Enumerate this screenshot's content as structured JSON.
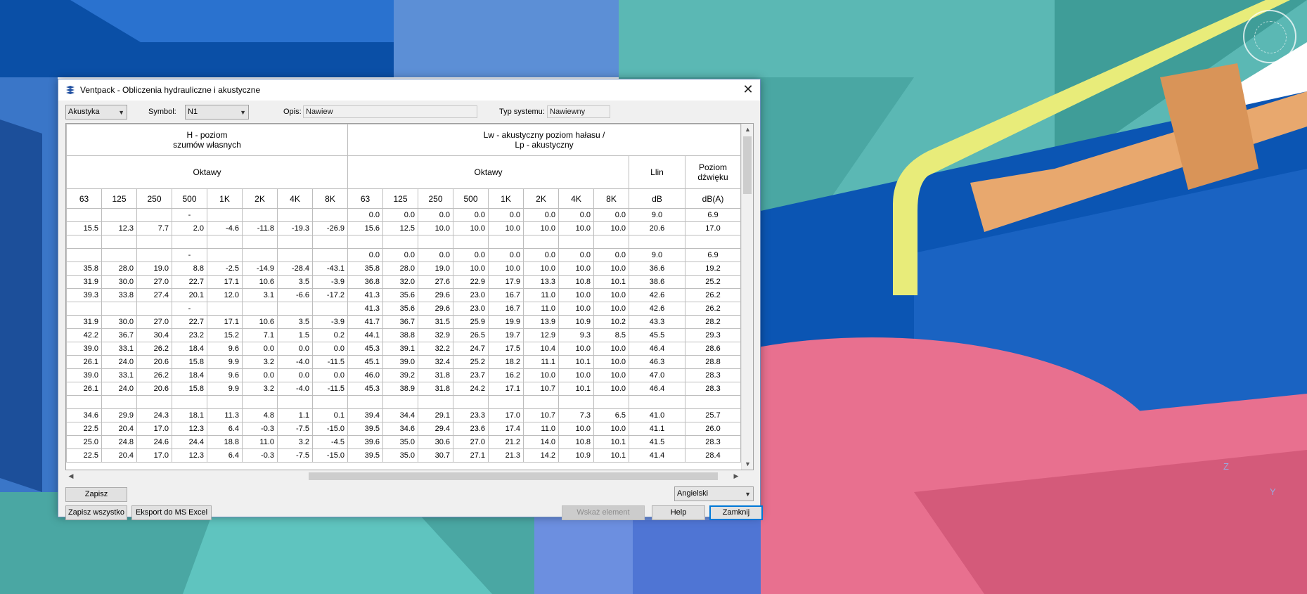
{
  "dialog": {
    "title": "Ventpack - Obliczenia hydrauliczne i akustyczne",
    "mode_select": "Akustyka",
    "symbol_label": "Symbol:",
    "symbol_value": "N1",
    "desc_label": "Opis:",
    "desc_value": "Nawiew",
    "system_type_label": "Typ systemu:",
    "system_type_value": "Nawiewny"
  },
  "table": {
    "group_h_line1": "H - poziom",
    "group_h_line2": "szumów własnych",
    "group_lw_line1": "Lw - akustyczny poziom hałasu /",
    "group_lw_line2": "Lp - akustyczny",
    "octaves_label_left": "Oktawy",
    "octaves_label_right": "Oktawy",
    "llin_label": "Llin",
    "sound_level_line1": "Poziom",
    "sound_level_line2": "dźwięku",
    "octave_bands": [
      "63",
      "125",
      "250",
      "500",
      "1K",
      "2K",
      "4K",
      "8K"
    ],
    "db_unit": "dB",
    "dba_unit": "dB(A)",
    "rows": [
      {
        "h": [
          "",
          "",
          "",
          "-",
          "",
          "",
          "",
          ""
        ],
        "lw": [
          "0.0",
          "0.0",
          "0.0",
          "0.0",
          "0.0",
          "0.0",
          "0.0",
          "0.0"
        ],
        "llin": "9.0",
        "la": "6.9"
      },
      {
        "h": [
          "15.5",
          "12.3",
          "7.7",
          "2.0",
          "-4.6",
          "-11.8",
          "-19.3",
          "-26.9"
        ],
        "lw": [
          "15.6",
          "12.5",
          "10.0",
          "10.0",
          "10.0",
          "10.0",
          "10.0",
          "10.0"
        ],
        "llin": "20.6",
        "la": "17.0"
      },
      {
        "h": [
          "",
          "",
          "",
          "",
          "",
          "",
          "",
          ""
        ],
        "lw": [
          "",
          "",
          "",
          "",
          "",
          "",
          "",
          ""
        ],
        "llin": "",
        "la": ""
      },
      {
        "h": [
          "",
          "",
          "",
          "-",
          "",
          "",
          "",
          ""
        ],
        "lw": [
          "0.0",
          "0.0",
          "0.0",
          "0.0",
          "0.0",
          "0.0",
          "0.0",
          "0.0"
        ],
        "llin": "9.0",
        "la": "6.9"
      },
      {
        "h": [
          "35.8",
          "28.0",
          "19.0",
          "8.8",
          "-2.5",
          "-14.9",
          "-28.4",
          "-43.1"
        ],
        "lw": [
          "35.8",
          "28.0",
          "19.0",
          "10.0",
          "10.0",
          "10.0",
          "10.0",
          "10.0"
        ],
        "llin": "36.6",
        "la": "19.2"
      },
      {
        "h": [
          "31.9",
          "30.0",
          "27.0",
          "22.7",
          "17.1",
          "10.6",
          "3.5",
          "-3.9"
        ],
        "lw": [
          "36.8",
          "32.0",
          "27.6",
          "22.9",
          "17.9",
          "13.3",
          "10.8",
          "10.1"
        ],
        "llin": "38.6",
        "la": "25.2"
      },
      {
        "h": [
          "39.3",
          "33.8",
          "27.4",
          "20.1",
          "12.0",
          "3.1",
          "-6.6",
          "-17.2"
        ],
        "lw": [
          "41.3",
          "35.6",
          "29.6",
          "23.0",
          "16.7",
          "11.0",
          "10.0",
          "10.0"
        ],
        "llin": "42.6",
        "la": "26.2"
      },
      {
        "h": [
          "",
          "",
          "",
          "-",
          "",
          "",
          "",
          ""
        ],
        "lw": [
          "41.3",
          "35.6",
          "29.6",
          "23.0",
          "16.7",
          "11.0",
          "10.0",
          "10.0"
        ],
        "llin": "42.6",
        "la": "26.2"
      },
      {
        "h": [
          "31.9",
          "30.0",
          "27.0",
          "22.7",
          "17.1",
          "10.6",
          "3.5",
          "-3.9"
        ],
        "lw": [
          "41.7",
          "36.7",
          "31.5",
          "25.9",
          "19.9",
          "13.9",
          "10.9",
          "10.2"
        ],
        "llin": "43.3",
        "la": "28.2"
      },
      {
        "h": [
          "42.2",
          "36.7",
          "30.4",
          "23.2",
          "15.2",
          "7.1",
          "1.5",
          "0.2"
        ],
        "lw": [
          "44.1",
          "38.8",
          "32.9",
          "26.5",
          "19.7",
          "12.9",
          "9.3",
          "8.5"
        ],
        "llin": "45.5",
        "la": "29.3"
      },
      {
        "h": [
          "39.0",
          "33.1",
          "26.2",
          "18.4",
          "9.6",
          "0.0",
          "0.0",
          "0.0"
        ],
        "lw": [
          "45.3",
          "39.1",
          "32.2",
          "24.7",
          "17.5",
          "10.4",
          "10.0",
          "10.0"
        ],
        "llin": "46.4",
        "la": "28.6"
      },
      {
        "h": [
          "26.1",
          "24.0",
          "20.6",
          "15.8",
          "9.9",
          "3.2",
          "-4.0",
          "-11.5"
        ],
        "lw": [
          "45.1",
          "39.0",
          "32.4",
          "25.2",
          "18.2",
          "11.1",
          "10.1",
          "10.0"
        ],
        "llin": "46.3",
        "la": "28.8"
      },
      {
        "h": [
          "39.0",
          "33.1",
          "26.2",
          "18.4",
          "9.6",
          "0.0",
          "0.0",
          "0.0"
        ],
        "lw": [
          "46.0",
          "39.2",
          "31.8",
          "23.7",
          "16.2",
          "10.0",
          "10.0",
          "10.0"
        ],
        "llin": "47.0",
        "la": "28.3"
      },
      {
        "h": [
          "26.1",
          "24.0",
          "20.6",
          "15.8",
          "9.9",
          "3.2",
          "-4.0",
          "-11.5"
        ],
        "lw": [
          "45.3",
          "38.9",
          "31.8",
          "24.2",
          "17.1",
          "10.7",
          "10.1",
          "10.0"
        ],
        "llin": "46.4",
        "la": "28.3"
      },
      {
        "h": [
          "",
          "",
          "",
          "",
          "",
          "",
          "",
          ""
        ],
        "lw": [
          "",
          "",
          "",
          "",
          "",
          "",
          "",
          ""
        ],
        "llin": "",
        "la": ""
      },
      {
        "h": [
          "34.6",
          "29.9",
          "24.3",
          "18.1",
          "11.3",
          "4.8",
          "1.1",
          "0.1"
        ],
        "lw": [
          "39.4",
          "34.4",
          "29.1",
          "23.3",
          "17.0",
          "10.7",
          "7.3",
          "6.5"
        ],
        "llin": "41.0",
        "la": "25.7"
      },
      {
        "h": [
          "22.5",
          "20.4",
          "17.0",
          "12.3",
          "6.4",
          "-0.3",
          "-7.5",
          "-15.0"
        ],
        "lw": [
          "39.5",
          "34.6",
          "29.4",
          "23.6",
          "17.4",
          "11.0",
          "10.0",
          "10.0"
        ],
        "llin": "41.1",
        "la": "26.0"
      },
      {
        "h": [
          "25.0",
          "24.8",
          "24.6",
          "24.4",
          "18.8",
          "11.0",
          "3.2",
          "-4.5"
        ],
        "lw": [
          "39.6",
          "35.0",
          "30.6",
          "27.0",
          "21.2",
          "14.0",
          "10.8",
          "10.1"
        ],
        "llin": "41.5",
        "la": "28.3"
      },
      {
        "h": [
          "22.5",
          "20.4",
          "17.0",
          "12.3",
          "6.4",
          "-0.3",
          "-7.5",
          "-15.0"
        ],
        "lw": [
          "39.5",
          "35.0",
          "30.7",
          "27.1",
          "21.3",
          "14.2",
          "10.9",
          "10.1"
        ],
        "llin": "41.4",
        "la": "28.4"
      }
    ]
  },
  "buttons": {
    "save": "Zapisz",
    "save_all": "Zapisz wszystko",
    "export_excel": "Eksport do MS Excel",
    "show_element": "Wskaż element",
    "help": "Help",
    "close": "Zamknij"
  },
  "language_select": "Angielski",
  "viewport": {
    "axis_z": "Z",
    "axis_y": "Y"
  },
  "colors": {
    "accent": "#0078d7",
    "duct_blue": "#0b55b3",
    "duct_teal": "#5bb8b4",
    "pipe_yellow": "#e8ec7a",
    "duct_pink": "#e8708f",
    "duct_orange": "#e8a86e"
  }
}
